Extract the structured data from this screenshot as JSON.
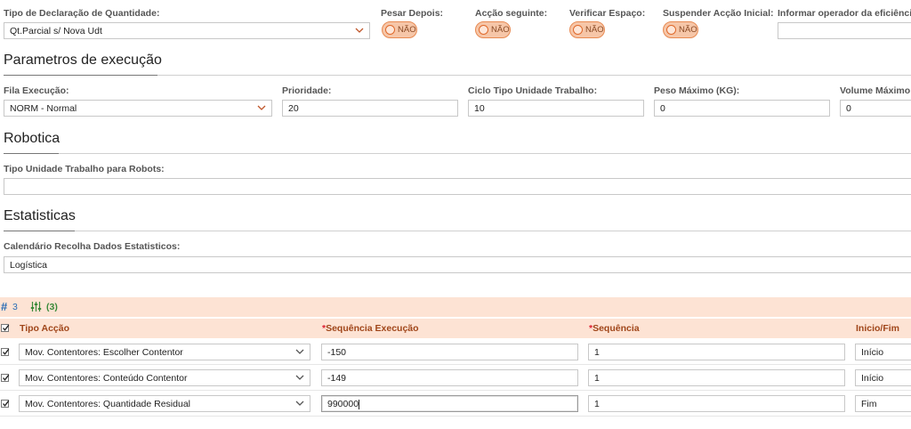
{
  "top": {
    "tipo_declaracao_label": "Tipo de Declaração de Quantidade:",
    "tipo_declaracao_value": "Qt.Parcial s/ Nova Udt",
    "pesar_depois_label": "Pesar Depois:",
    "accao_seguinte_label": "Acção seguinte:",
    "verificar_espaco_label": "Verificar Espaço:",
    "suspender_label": "Suspender Acção Inicial:",
    "informar_operador_label": "Informar operador da eficiência:",
    "toggle_off_text": "NÃO"
  },
  "execucao": {
    "title": "Parametros de execução",
    "fila_label": "Fila Execução:",
    "fila_value": "NORM - Normal",
    "prioridade_label": "Prioridade:",
    "prioridade_value": "20",
    "ciclo_label": "Ciclo Tipo Unidade Trabalho:",
    "ciclo_value": "10",
    "peso_label": "Peso Máximo (KG):",
    "peso_value": "0",
    "volume_label": "Volume Máximo (",
    "volume_value": "0"
  },
  "robotica": {
    "title": "Robotica",
    "tipo_label": "Tipo Unidade Trabalho para Robots:",
    "tipo_value": ""
  },
  "estatisticas": {
    "title": "Estatisticas",
    "calendario_label": "Calendário Recolha Dados Estatisticos:",
    "calendario_value": "Logística"
  },
  "grid": {
    "row_count": "3",
    "filter_count": "(3)",
    "columns": {
      "tipo_accao": "Tipo Acção",
      "seq_execucao": "Sequência Execução",
      "sequencia": "Sequência",
      "inicio_fim": "Inicio/Fim"
    },
    "required_mark": "*",
    "rows": [
      {
        "tipo": "Mov. Contentores: Escolher Contentor",
        "seq_exec": "-150",
        "seq": "1",
        "inicio_fim": "Início"
      },
      {
        "tipo": "Mov. Contentores: Conteúdo Contentor",
        "seq_exec": "-149",
        "seq": "1",
        "inicio_fim": "Início"
      },
      {
        "tipo": "Mov. Contentores: Quantidade Residual",
        "seq_exec": "990000",
        "seq": "1",
        "inicio_fim": "Fim"
      }
    ]
  },
  "colors": {
    "accent": "#e0692a",
    "header_bg": "#fde3d4",
    "header_text": "#a0461a",
    "toolbar_blue": "#2a6db5",
    "toolbar_green": "#3a8a3a"
  }
}
